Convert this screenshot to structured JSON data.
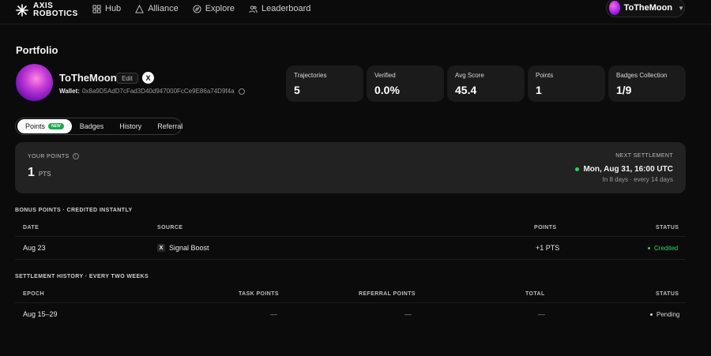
{
  "brand": {
    "line1": "AXIS",
    "line2": "ROBOTICS"
  },
  "nav": [
    {
      "label": "Hub",
      "icon": "grid-icon"
    },
    {
      "label": "Alliance",
      "icon": "triangle-icon"
    },
    {
      "label": "Explore",
      "icon": "compass-icon"
    },
    {
      "label": "Leaderboard",
      "icon": "users-icon"
    }
  ],
  "user": {
    "name": "ToTheMoon"
  },
  "portfolio": {
    "title": "Portfolio",
    "name": "ToTheMoon",
    "edit_label": "Edit",
    "x_label": "X",
    "wallet_label": "Wallet:",
    "wallet_address": "0x8a9D5AdD7cFad3D40d947000FcCe9E86a74D9f4a"
  },
  "stats": [
    {
      "label": "Trajectories",
      "value": "5"
    },
    {
      "label": "Verified",
      "value": "0.0%"
    },
    {
      "label": "Avg Score",
      "value": "45.4"
    },
    {
      "label": "Points",
      "value": "1"
    },
    {
      "label": "Badges Collection",
      "value": "1/9"
    }
  ],
  "tabs": [
    {
      "label": "Points",
      "badge": "NEW"
    },
    {
      "label": "Badges"
    },
    {
      "label": "History"
    },
    {
      "label": "Referral"
    }
  ],
  "points_panel": {
    "your_points_label": "YOUR POINTS",
    "info_glyph": "i",
    "value": "1",
    "unit": "PTS",
    "next_settlement_label": "NEXT SETTLEMENT",
    "next_settlement_date": "Mon, Aug 31, 16:00 UTC",
    "next_settlement_sub": "In 8 days · every 14 days"
  },
  "bonus": {
    "title": "BONUS POINTS · CREDITED INSTANTLY",
    "headers": {
      "date": "DATE",
      "source": "SOURCE",
      "points": "POINTS",
      "status": "STATUS"
    },
    "rows": [
      {
        "date": "Aug 23",
        "source_icon": "X",
        "source": "Signal Boost",
        "points": "+1 PTS",
        "status": "Credited"
      }
    ]
  },
  "settlement": {
    "title": "SETTLEMENT HISTORY · EVERY TWO WEEKS",
    "headers": {
      "epoch": "EPOCH",
      "task_points": "TASK POINTS",
      "referral_points": "REFERRAL POINTS",
      "total": "TOTAL",
      "status": "STATUS"
    },
    "rows": [
      {
        "epoch": "Aug 15–29",
        "task_points": "—",
        "referral_points": "—",
        "total": "—",
        "status": "Pending"
      }
    ]
  },
  "colors": {
    "background": "#0b0b0b",
    "panel": "#222222",
    "accent_green": "#27d35e"
  }
}
